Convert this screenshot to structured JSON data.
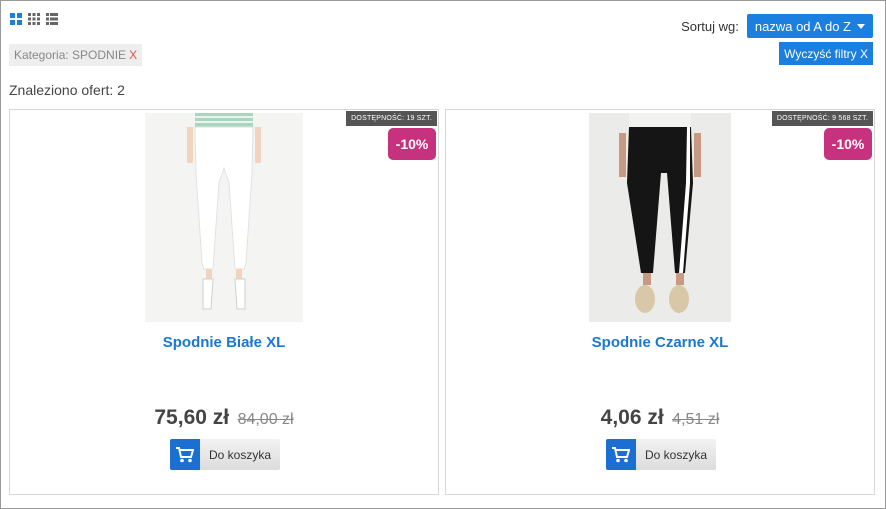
{
  "toolbar": {
    "sort_label": "Sortuj wg:",
    "sort_value": "nazwa od A do Z",
    "clear_filters": "Wyczyść filtry X"
  },
  "filter": {
    "label": "Kategoria: SPODNIE",
    "remove": "X"
  },
  "results": {
    "count_text": "Znaleziono ofert: 2"
  },
  "products": [
    {
      "name": "Spodnie Białe XL",
      "stock": "DOSTĘPNOŚĆ: 19 SZT.",
      "discount": "-10%",
      "price": "75,60 zł",
      "old_price": "84,00 zł",
      "cart_label": "Do koszyka"
    },
    {
      "name": "Spodnie Czarne XL",
      "stock": "DOSTĘPNOŚĆ: 9 568 SZT.",
      "discount": "-10%",
      "price": "4,06 zł",
      "old_price": "4,51 zł",
      "cart_label": "Do koszyka"
    }
  ],
  "colors": {
    "accent": "#1b7fdf",
    "discount": "#c7327e",
    "link": "#1b78cf"
  }
}
